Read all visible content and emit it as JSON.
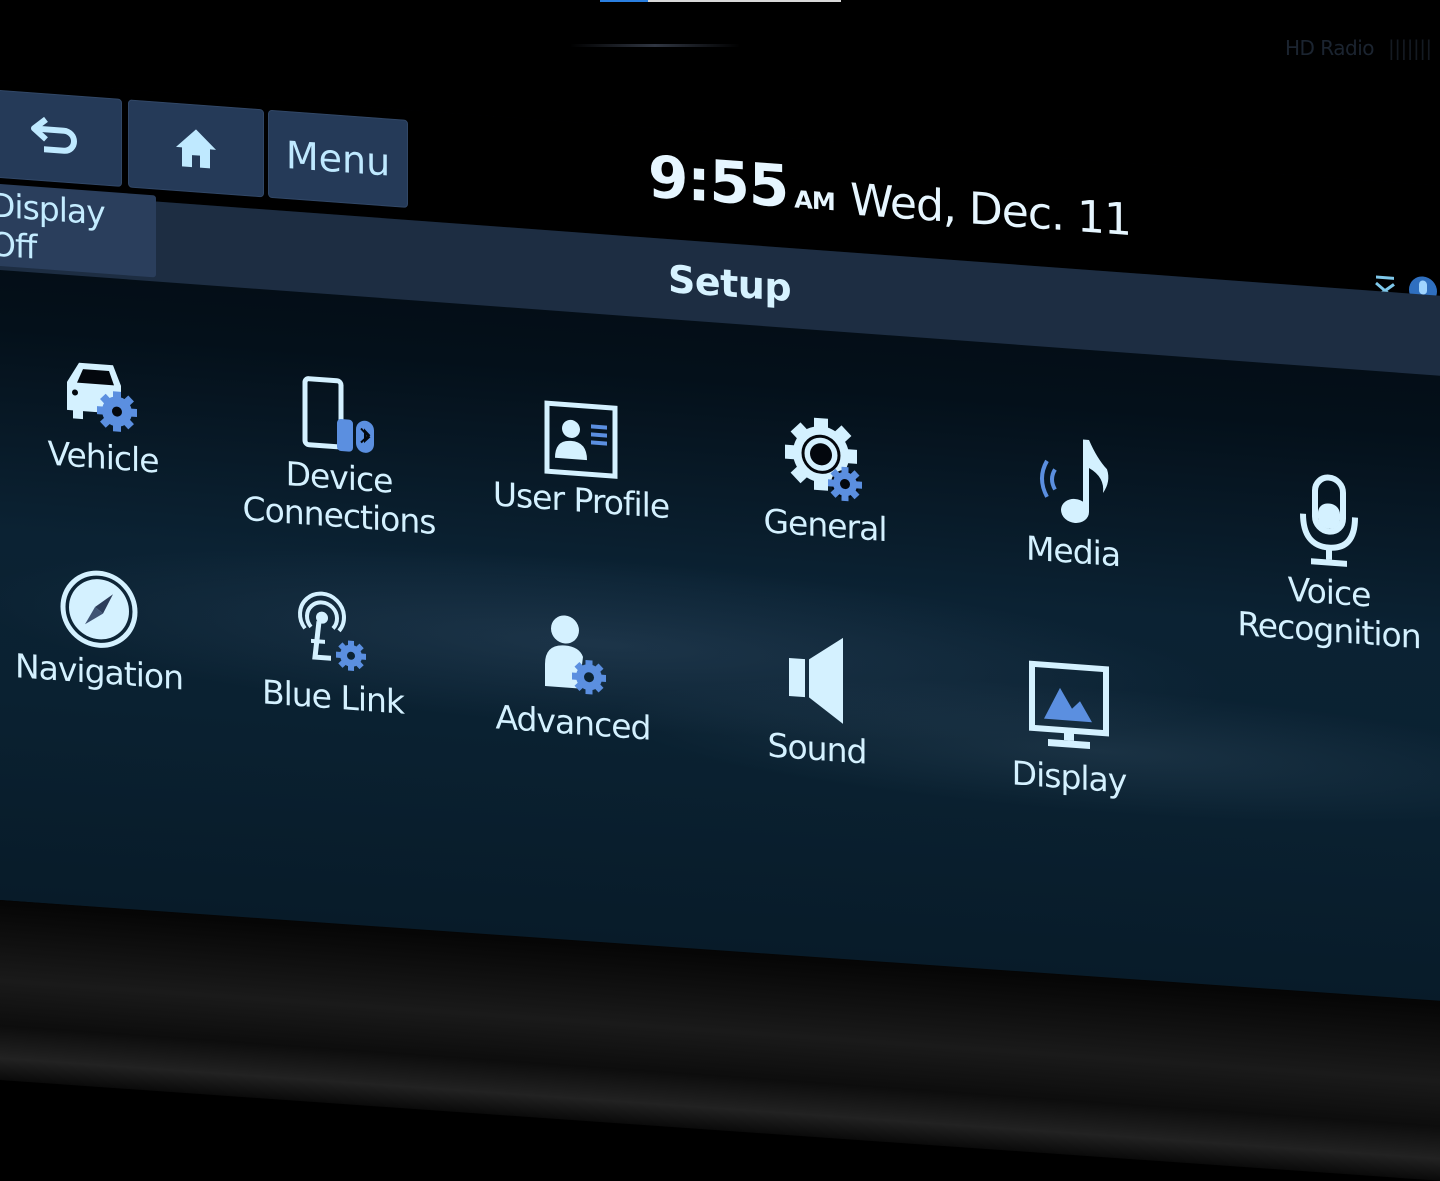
{
  "video_overlay": {
    "progress_fraction": 0.2,
    "progress_fill_color": "#2a7fe0"
  },
  "bezel": {
    "radio_badge": "HD Radio",
    "radio_badge_extra": "|||||||"
  },
  "header": {
    "back_icon": "back-arrow-icon",
    "home_icon": "home-icon",
    "menu_label": "Menu",
    "display_off_label": "Display Off",
    "time": "9:55",
    "ampm": "AM",
    "date": "Wed, Dec. 11",
    "page_title": "Setup",
    "status_icons": [
      "signal-off-icon",
      "voice-assistant-icon"
    ]
  },
  "colors": {
    "accent_blue": "#5b8fe0",
    "icon_light": "#d4f1ff",
    "button_bg": "#253a58",
    "title_bar_bg": "#1d2d42"
  },
  "setup_items": [
    {
      "id": "vehicle",
      "label": "Vehicle",
      "icon": "car-gear-icon"
    },
    {
      "id": "device-connections",
      "label": "Device\nConnections",
      "icon": "phone-usb-bluetooth-icon"
    },
    {
      "id": "user-profile",
      "label": "User Profile",
      "icon": "profile-card-icon"
    },
    {
      "id": "general",
      "label": "General",
      "icon": "gear-icon"
    },
    {
      "id": "media",
      "label": "Media",
      "icon": "music-note-icon"
    },
    {
      "id": "voice-recognition",
      "label": "Voice\nRecognition",
      "icon": "microphone-icon"
    },
    {
      "id": "navigation",
      "label": "Navigation",
      "icon": "compass-icon"
    },
    {
      "id": "blue-link",
      "label": "Blue Link",
      "icon": "blue-link-gear-icon"
    },
    {
      "id": "advanced",
      "label": "Advanced",
      "icon": "person-gear-icon"
    },
    {
      "id": "sound",
      "label": "Sound",
      "icon": "speaker-icon"
    },
    {
      "id": "display",
      "label": "Display",
      "icon": "monitor-icon"
    }
  ]
}
